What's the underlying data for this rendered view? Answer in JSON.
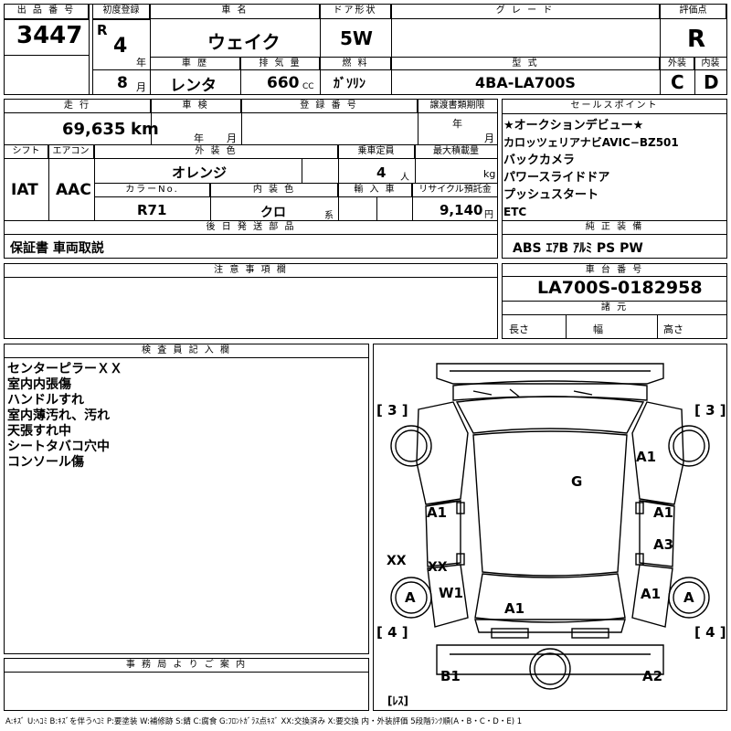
{
  "top": {
    "h_lot": "出 品 番 号",
    "lot": "3447",
    "h_first_reg": "初度登録",
    "era": "R",
    "reg_year": "4",
    "year_unit": "年",
    "reg_month": "8",
    "month_unit": "月",
    "h_model": "車 名",
    "model": "ウェイク",
    "h_door": "ドア形状",
    "door": "5W",
    "h_grade": "グ レ ー ド",
    "grade": "",
    "h_score": "評価点",
    "score": "R",
    "h_history": "車 歴",
    "history": "レンタ",
    "h_displacement": "排 気 量",
    "displacement": "660",
    "cc": "CC",
    "h_fuel": "燃 料",
    "fuel": "ｶﾞｿﾘﾝ",
    "h_type": "型 式",
    "type": "4BA-LA700S",
    "h_ext": "外装",
    "ext": "C",
    "h_int": "内装",
    "int": "D"
  },
  "mid": {
    "h_mileage": "走 行",
    "mileage": "69,635",
    "km": "km",
    "h_inspection": "車 検",
    "insp_year": "年",
    "insp_month": "月",
    "h_regno": "登 録 番 号",
    "h_handover": "譲渡書類期限",
    "ho_year": "年",
    "ho_month": "月",
    "h_shift": "シフト",
    "shift": "IAT",
    "h_ac": "エアコン",
    "ac": "AAC",
    "h_color": "外 装 色",
    "color": "オレンジ",
    "h_capacity": "乗車定員",
    "capacity": "4",
    "person": "人",
    "h_load": "最大積載量",
    "kg": "kg",
    "h_colorno": "カラーNo.",
    "colorno": "R71",
    "h_intcolor": "内 装 色",
    "intcolor": "クロ",
    "kei": "系",
    "h_import": "輸 入 車",
    "h_recycle": "リサイクル預託金",
    "recycle": "9,140",
    "yen": "円",
    "h_later": "後 日 発 送 部 品",
    "later": "保証書 車両取説"
  },
  "sales": {
    "h": "セールスポイント",
    "items": [
      "★オークションデビュー★",
      "カロッツェリアナビAVIC−BZ501",
      "バックカメラ",
      "パワースライドドア",
      "プッシュスタート",
      "ETC"
    ]
  },
  "equip": {
    "h": "純 正 装 備",
    "items": "ABS ｴｱB ｱﾙﾐ PS PW"
  },
  "caution": {
    "h": "注 意 事 項 欄"
  },
  "chassis": {
    "h": "車 台 番 号",
    "no": "LA700S-0182958",
    "h_dims": "諸 元",
    "length": "長さ",
    "width": "幅",
    "height": "高さ"
  },
  "inspector": {
    "h": "検 査 員 記 入 欄",
    "lines": [
      "センターピラーＸＸ",
      "室内内張傷",
      "ハンドルすれ",
      "室内薄汚れ、汚れ",
      "天張すれ中",
      "シートタバコ穴中",
      "コンソール傷"
    ]
  },
  "office": {
    "h": "事 務 局 よ り ご 案 内"
  },
  "diagram": {
    "tire_fl": "A",
    "tire_fr": "A",
    "tread_fl": "[ 3 ]",
    "tread_fr": "[ 3 ]",
    "tread_rl": "[ 4 ]",
    "tread_rr": "[ 4 ]",
    "spare": "[ﾚｽ]",
    "marks": {
      "a1_rf": "A1",
      "g_roof": "G",
      "a1_lf_door": "A1",
      "a1_rf_door": "A1",
      "a3_rr_door": "A3",
      "xx_lpillar": "XX",
      "xx_lpillar2": "XX",
      "w1_lrear": "W1",
      "a1_rq": "A1",
      "a1_rear": "A1",
      "b1": "B1",
      "a2": "A2"
    }
  },
  "legend": "A:ｷｽﾞ U:ﾍｺﾐ B:ｷｽﾞを伴うﾍｺﾐ P:要塗装 W:補修跡 S:錆 C:腐食 G:ﾌﾛﾝﾄｶﾞﾗｽ点ｷｽﾞ XX:交換済み X:要交換 内・外装評価 5段階ﾗﾝｸ順(A・B・C・D・E) 1"
}
